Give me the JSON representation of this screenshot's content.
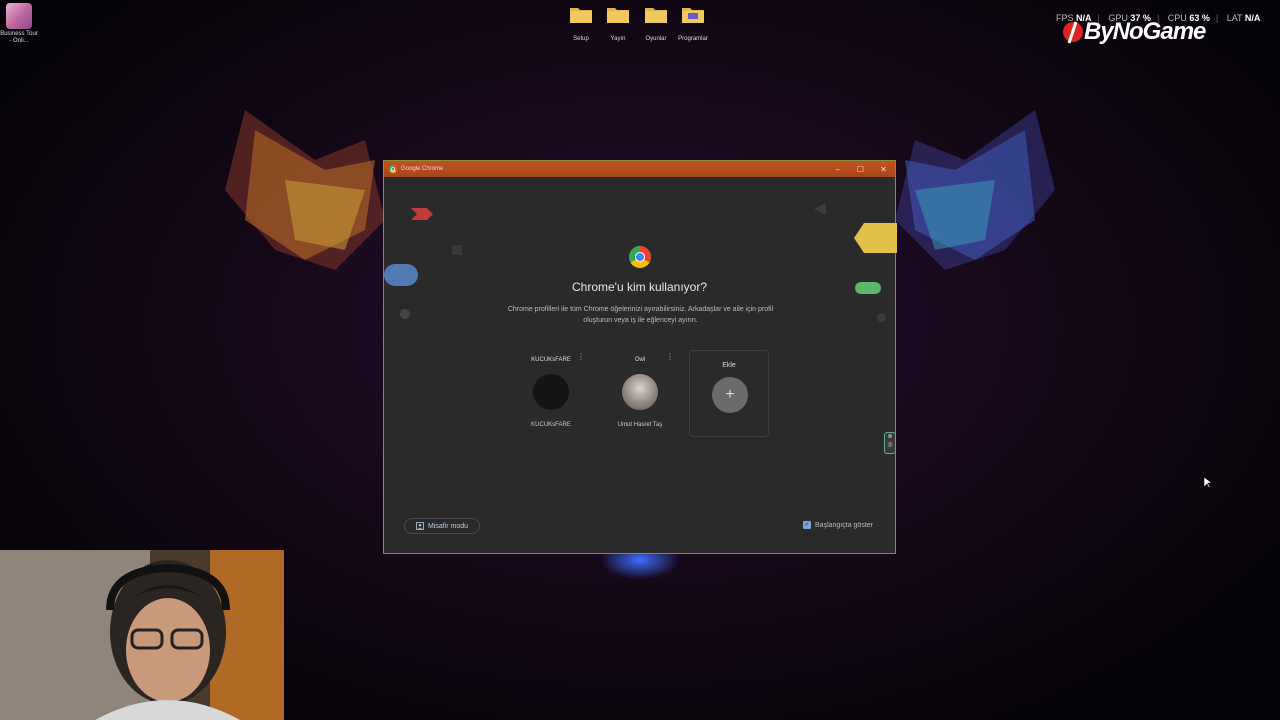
{
  "desktop": {
    "app": {
      "label": "Business Tour - Onli..."
    },
    "folders": [
      {
        "label": "Setup"
      },
      {
        "label": "Yayın"
      },
      {
        "label": "Oyunlar"
      },
      {
        "label": "Programlar"
      }
    ]
  },
  "overlay": {
    "stats": [
      {
        "label": "FPS",
        "value": "N/A"
      },
      {
        "label": "GPU",
        "value": "37 %"
      },
      {
        "label": "CPU",
        "value": "63 %"
      },
      {
        "label": "LAT",
        "value": "N/A"
      }
    ],
    "logo_text": "ByNoGame"
  },
  "window": {
    "title": "Google Chrome",
    "controls": {
      "minimize": "–",
      "maximize": "☐",
      "close": "✕"
    }
  },
  "profile_picker": {
    "heading": "Chrome'u kim kullanıyor?",
    "subtext": "Chrome profilleri ile tüm Chrome öğelerinizi ayırabilirsiniz. Arkadaşlar ve aile için profil oluşturun veya iş ile eğlenceyi ayırın.",
    "profiles": [
      {
        "name": "KUCUKsFARE",
        "sub": "KUCUKsFARE"
      },
      {
        "name": "Owl",
        "sub": "Umut Hasret Taş"
      }
    ],
    "add_label": "Ekle",
    "guest_label": "Misafir modu",
    "startup_label": "Başlangıçta göster",
    "startup_checked": "✓"
  },
  "colors": {
    "titlebar": "#b84d1c",
    "window_bg": "#2a2a2b",
    "accent": "#7aa2d8"
  }
}
